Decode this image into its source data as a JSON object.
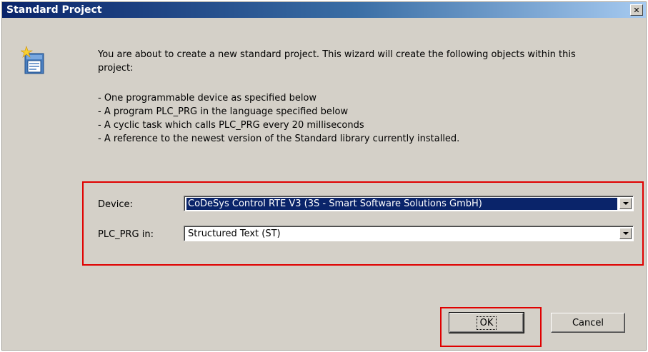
{
  "dialog": {
    "title": "Standard Project",
    "close_glyph": "✕",
    "icon": "wizard-icon",
    "intro": "You are about to create a new standard project. This wizard will create the following objects within this project:",
    "bullets": [
      "- One programmable device as specified below",
      "- A program PLC_PRG in the language specified below",
      "- A cyclic task which calls PLC_PRG every 20 milliseconds",
      "- A reference to the newest version of the Standard library currently installed."
    ]
  },
  "form": {
    "device_label": "Device:",
    "device_value": "CoDeSys Control RTE V3 (3S - Smart Software Solutions GmbH)",
    "plc_label": "PLC_PRG in:",
    "plc_value": "Structured Text (ST)"
  },
  "buttons": {
    "ok": "OK",
    "cancel": "Cancel"
  },
  "colors": {
    "highlight_box": "#e00000",
    "selection": "#0a246a",
    "dialog_bg": "#d4d0c8"
  }
}
